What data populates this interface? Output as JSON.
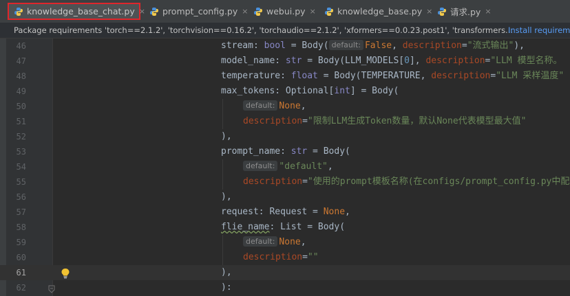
{
  "tabs": [
    {
      "label": "knowledge_base_chat.py",
      "close": "×"
    },
    {
      "label": "prompt_config.py",
      "close": "×"
    },
    {
      "label": "webui.py",
      "close": "×"
    },
    {
      "label": "knowledge_base.py",
      "close": "×"
    },
    {
      "label": "请求.py",
      "close": "×"
    }
  ],
  "notice": {
    "message": "Package requirements 'torch==2.1.2', 'torchvision==0.16.2', 'torchaudio==2.1.2', 'xformers==0.0.23.post1', 'transformers...",
    "action": "Install requirements"
  },
  "editor": {
    "line_numbers": [
      "46",
      "47",
      "48",
      "49",
      "50",
      "51",
      "52",
      "53",
      "54",
      "55",
      "56",
      "57",
      "58",
      "59",
      "60",
      "61",
      "62"
    ],
    "current_line": "61",
    "lines": [
      [
        {
          "t": "stream: "
        },
        {
          "t": "bool",
          "c": "bi"
        },
        {
          "t": " = Body("
        },
        {
          "t": "default:",
          "c": "hint"
        },
        {
          "t": "False",
          "c": "kw"
        },
        {
          "t": ", "
        },
        {
          "t": "description",
          "c": "param"
        },
        {
          "t": "="
        },
        {
          "t": "\"流式输出\"",
          "c": "str"
        },
        {
          "t": "),"
        }
      ],
      [
        {
          "t": "model_name: "
        },
        {
          "t": "str",
          "c": "bi"
        },
        {
          "t": " = Body(LLM_MODELS["
        },
        {
          "t": "0",
          "c": "num"
        },
        {
          "t": "], "
        },
        {
          "t": "description",
          "c": "param"
        },
        {
          "t": "="
        },
        {
          "t": "\"LLM 模型名称。",
          "c": "str"
        }
      ],
      [
        {
          "t": "temperature: "
        },
        {
          "t": "float",
          "c": "bi"
        },
        {
          "t": " = Body(TEMPERATURE, "
        },
        {
          "t": "description",
          "c": "param"
        },
        {
          "t": "="
        },
        {
          "t": "\"LLM 采样温度\"",
          "c": "str"
        }
      ],
      [
        {
          "t": "max_tokens: Optional["
        },
        {
          "t": "int",
          "c": "bi"
        },
        {
          "t": "] = Body("
        }
      ],
      [
        {
          "t": "default:",
          "c": "hint"
        },
        {
          "t": "None",
          "c": "kw"
        },
        {
          "t": ","
        }
      ],
      [
        {
          "t": "description",
          "c": "param"
        },
        {
          "t": "="
        },
        {
          "t": "\"限制LLM生成Token数量，默认None代表模型最大值\"",
          "c": "str"
        }
      ],
      [
        {
          "t": "),"
        }
      ],
      [
        {
          "t": "prompt_name: "
        },
        {
          "t": "str",
          "c": "bi"
        },
        {
          "t": " = Body("
        }
      ],
      [
        {
          "t": "default:",
          "c": "hint"
        },
        {
          "t": "\"default\"",
          "c": "str"
        },
        {
          "t": ","
        }
      ],
      [
        {
          "t": "description",
          "c": "param"
        },
        {
          "t": "="
        },
        {
          "t": "\"使用的prompt模板名称(在configs/prompt_config.py中配",
          "c": "str"
        }
      ],
      [
        {
          "t": "),"
        }
      ],
      [
        {
          "t": "request: Request = "
        },
        {
          "t": "None",
          "c": "kw"
        },
        {
          "t": ","
        }
      ],
      [
        {
          "t": "flie_name",
          "c": "wavy"
        },
        {
          "t": ": List = Body("
        }
      ],
      [
        {
          "t": "default:",
          "c": "hint"
        },
        {
          "t": "None",
          "c": "kw"
        },
        {
          "t": ","
        }
      ],
      [
        {
          "t": "description",
          "c": "param"
        },
        {
          "t": "="
        },
        {
          "t": "\"\"",
          "c": "str"
        }
      ],
      [
        {
          "t": "),"
        }
      ],
      [
        {
          "t": "):"
        }
      ]
    ]
  }
}
